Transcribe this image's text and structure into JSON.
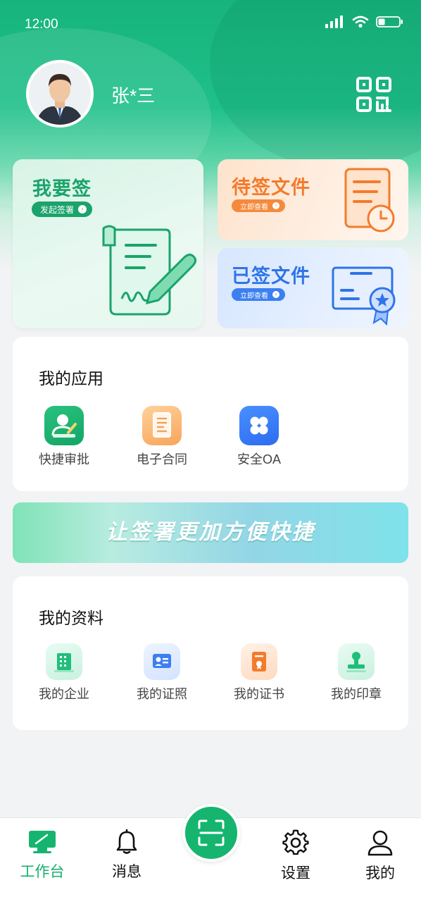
{
  "status_bar": {
    "time": "12:00"
  },
  "profile": {
    "name": "张*三"
  },
  "quick_cards": {
    "sign": {
      "title": "我要签",
      "action": "发起签署",
      "color": "#1aa36a"
    },
    "pending": {
      "title": "待签文件",
      "action": "立即查看",
      "color": "#f37b2d"
    },
    "signed": {
      "title": "已签文件",
      "action": "立即查看",
      "color": "#2f74e8"
    }
  },
  "my_apps": {
    "title": "我的应用",
    "items": [
      {
        "label": "快捷审批",
        "icon": "approval-icon"
      },
      {
        "label": "电子合同",
        "icon": "contract-icon"
      },
      {
        "label": "安全OA",
        "icon": "oa-icon"
      }
    ]
  },
  "banner": {
    "text": "让签署更加方便快捷"
  },
  "my_profile": {
    "title": "我的资料",
    "items": [
      {
        "label": "我的企业",
        "icon": "enterprise-icon"
      },
      {
        "label": "我的证照",
        "icon": "license-icon"
      },
      {
        "label": "我的证书",
        "icon": "certificate-icon"
      },
      {
        "label": "我的印章",
        "icon": "seal-icon"
      }
    ]
  },
  "tabbar": {
    "items": [
      {
        "label": "工作台",
        "icon": "workbench-icon",
        "active": true
      },
      {
        "label": "消息",
        "icon": "bell-icon"
      },
      {
        "label": "设置",
        "icon": "gear-icon"
      },
      {
        "label": "我的",
        "icon": "user-icon"
      }
    ],
    "center_icon": "scan-icon"
  },
  "colors": {
    "brand": "#16b56f"
  }
}
